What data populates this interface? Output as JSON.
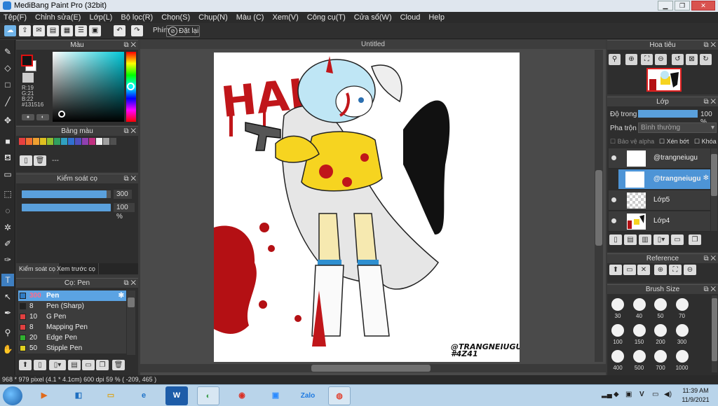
{
  "window": {
    "title": "MediBang Paint Pro (32bit)"
  },
  "menubar": [
    "Tệp(F)",
    "Chỉnh sửa(E)",
    "Lớp(L)",
    "Bộ lọc(R)",
    "Chọn(S)",
    "Chụp(N)",
    "Màu (C)",
    "Xem(V)",
    "Công cụ(T)",
    "Cửa sổ(W)",
    "Cloud",
    "Help"
  ],
  "toolbar": {
    "pin_label": "Phím",
    "reset_label": "Đặt lại"
  },
  "color_panel": {
    "title": "Màu",
    "r": "R:19",
    "g": "G:21",
    "b": "B:22",
    "hex": "#131516"
  },
  "palette_panel": {
    "title": "Bảng màu",
    "placeholder": "---",
    "colors": [
      "#e84040",
      "#f07030",
      "#f0a030",
      "#e0c020",
      "#90c030",
      "#30a060",
      "#30a0c0",
      "#3070d0",
      "#5050c0",
      "#9040b0",
      "#c03080",
      "#f0f0f0",
      "#a0a0a0",
      "#505050"
    ]
  },
  "brush_control": {
    "title": "Kiểm soát cọ",
    "size": "300",
    "opacity": "100 %",
    "size_fraction": 0.95,
    "opacity_fraction": 1.0
  },
  "tabs": {
    "brush_control": "Kiểm soát cọ",
    "brush_preview": "Xem trước cọ"
  },
  "brush_panel": {
    "title": "Cọ: Pen",
    "items": [
      {
        "size": "300",
        "name": "Pen",
        "color": "#e04040"
      },
      {
        "size": "8",
        "name": "Pen (Sharp)",
        "color": "#222222"
      },
      {
        "size": "10",
        "name": "G Pen",
        "color": "#e04040"
      },
      {
        "size": "8",
        "name": "Mapping Pen",
        "color": "#e04040"
      },
      {
        "size": "20",
        "name": "Edge Pen",
        "color": "#30b030"
      },
      {
        "size": "50",
        "name": "Stipple Pen",
        "color": "#e0d020"
      }
    ]
  },
  "document": {
    "title": "Untitled",
    "watermark": "@TRANGNEIUGU",
    "watermark_date": "#4Z41",
    "art_text": "HAHA"
  },
  "navigator": {
    "title": "Hoa tiêu"
  },
  "layer_panel": {
    "title": "Lớp",
    "opacity_label": "Độ trong",
    "opacity_value": "100 %",
    "blend_label": "Pha trộn",
    "blend_value": "Bình thường",
    "protect_alpha": "Bảo vệ alpha",
    "clipping": "Xén bớt",
    "lock": "Khóa",
    "layers": [
      {
        "name": "@trangneiugu",
        "selected": false
      },
      {
        "name": "@trangneiugu",
        "selected": true
      },
      {
        "name": "Lớp5",
        "selected": false
      },
      {
        "name": "Lớp4",
        "selected": false
      }
    ]
  },
  "reference_panel": {
    "title": "Reference"
  },
  "brush_size_panel": {
    "title": "Brush Size",
    "sizes": [
      "30",
      "40",
      "50",
      "70",
      "100",
      "150",
      "200",
      "300",
      "400",
      "500",
      "700",
      "1000"
    ]
  },
  "statusbar": {
    "text": "968 * 979 pixel  (4.1 * 4.1cm)  600 dpi  59 %  ( -209, 465 )"
  },
  "taskbar": {
    "time": "11:39 AM",
    "date": "11/9/2021",
    "zalo": "Zalo",
    "lang": "V"
  }
}
